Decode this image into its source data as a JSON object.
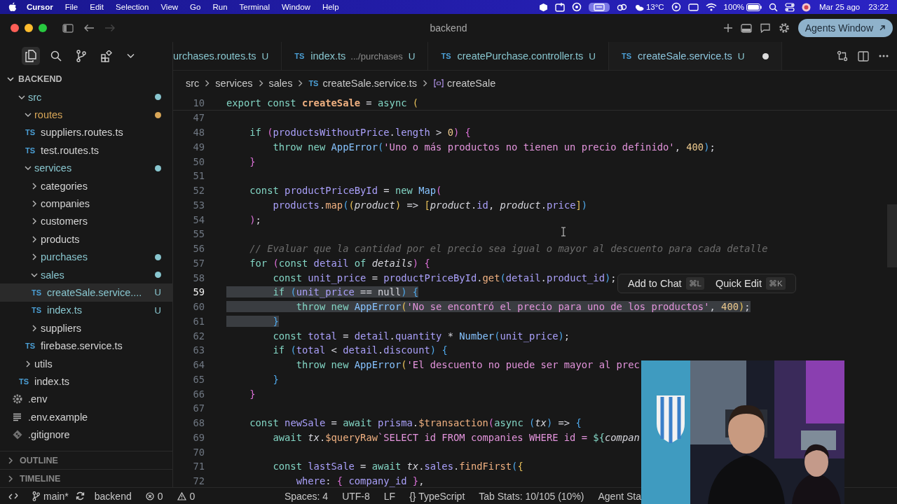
{
  "menubar": {
    "app": "Cursor",
    "items": [
      "File",
      "Edit",
      "Selection",
      "View",
      "Go",
      "Run",
      "Terminal",
      "Window",
      "Help"
    ],
    "weather": "13°C",
    "battery": "100%",
    "date": "Mar 25 ago",
    "time": "23:22"
  },
  "window": {
    "title": "backend",
    "agents_button": "Agents Window"
  },
  "tabs": [
    {
      "label": "urchases.routes.ts",
      "badge": "U",
      "selected": false,
      "dirty": false
    },
    {
      "type_label": "TS",
      "label": "index.ts",
      "description": ".../purchases",
      "badge": "U",
      "selected": false,
      "dirty": false
    },
    {
      "type_label": "TS",
      "label": "createPurchase.controller.ts",
      "badge": "U",
      "selected": false,
      "dirty": false
    },
    {
      "type_label": "TS",
      "label": "createSale.service.ts",
      "badge": "U",
      "selected": true,
      "dirty": true
    }
  ],
  "breadcrumb": [
    {
      "kind": "folder",
      "text": "src"
    },
    {
      "kind": "folder",
      "text": "services"
    },
    {
      "kind": "folder",
      "text": "sales"
    },
    {
      "kind": "file",
      "type_label": "TS",
      "text": "createSale.service.ts"
    },
    {
      "kind": "symbol",
      "text": "createSale"
    }
  ],
  "explorer": {
    "title": "BACKEND",
    "expanded": true,
    "tree": [
      {
        "label": "src",
        "kind": "folder",
        "expanded": true,
        "color": "#88c6cf",
        "selected": false,
        "children": [
          {
            "label": "routes",
            "kind": "folder",
            "expanded": true,
            "color": "#d8a657",
            "selected": false,
            "children": [
              {
                "label": "suppliers.routes.ts",
                "kind": "file",
                "type_label": "TS",
                "selected": false
              },
              {
                "label": "test.routes.ts",
                "kind": "file",
                "type_label": "TS",
                "selected": false
              }
            ]
          },
          {
            "label": "services",
            "kind": "folder",
            "expanded": true,
            "color": "#88c6cf",
            "selected": false,
            "children": [
              {
                "label": "categories",
                "kind": "folder",
                "expanded": false,
                "selected": false
              },
              {
                "label": "companies",
                "kind": "folder",
                "expanded": false,
                "selected": false
              },
              {
                "label": "customers",
                "kind": "folder",
                "expanded": false,
                "selected": false
              },
              {
                "label": "products",
                "kind": "folder",
                "expanded": false,
                "selected": false
              },
              {
                "label": "purchases",
                "kind": "folder",
                "expanded": false,
                "color": "#88c6cf",
                "selected": false
              },
              {
                "label": "sales",
                "kind": "folder",
                "expanded": true,
                "color": "#88c6cf",
                "selected": false,
                "children": [
                  {
                    "label": "createSale.service....",
                    "kind": "file",
                    "type_label": "TS",
                    "color": "#88c6cf",
                    "badge": "U",
                    "selected": true
                  },
                  {
                    "label": "index.ts",
                    "kind": "file",
                    "type_label": "TS",
                    "color": "#88c6cf",
                    "badge": "U",
                    "selected": false
                  }
                ]
              },
              {
                "label": "suppliers",
                "kind": "folder",
                "expanded": false,
                "selected": false
              },
              {
                "label": "firebase.service.ts",
                "kind": "file",
                "type_label": "TS",
                "selected": false
              }
            ]
          },
          {
            "label": "utils",
            "kind": "folder",
            "expanded": false,
            "selected": false
          },
          {
            "label": "index.ts",
            "kind": "file",
            "type_label": "TS",
            "selected": false
          }
        ]
      },
      {
        "label": ".env",
        "kind": "settings",
        "selected": false
      },
      {
        "label": ".env.example",
        "kind": "text",
        "selected": false
      },
      {
        "label": ".gitignore",
        "kind": "git",
        "selected": false
      }
    ]
  },
  "panels": [
    {
      "title": "OUTLINE",
      "expanded": false
    },
    {
      "title": "TIMELINE",
      "expanded": false
    }
  ],
  "sticky_line": {
    "number": "10",
    "tokens": [
      {
        "kind": "keyword",
        "text": "export const "
      },
      {
        "kind": "declaration",
        "text": "createSale"
      },
      {
        "kind": "punctuation",
        "text": " = "
      },
      {
        "kind": "keyword",
        "text": "async "
      },
      {
        "kind": "bracket1",
        "text": "("
      }
    ]
  },
  "code_lines": [
    {
      "number": "47"
    },
    {
      "number": "48",
      "selected": false,
      "current": false,
      "tokens": [
        {
          "kind": "keyword",
          "text": "    if "
        },
        {
          "kind": "bracket2",
          "text": "("
        },
        {
          "kind": "variable",
          "text": "productsWithoutPrice"
        },
        {
          "kind": "punctuation",
          "text": "."
        },
        {
          "kind": "property",
          "text": "length"
        },
        {
          "kind": "punctuation",
          "text": " > "
        },
        {
          "kind": "number",
          "text": "0"
        },
        {
          "kind": "bracket2",
          "text": ")"
        },
        {
          "kind": "bracket2",
          "text": " {"
        }
      ]
    },
    {
      "number": "49",
      "selected": false,
      "current": false,
      "tokens": [
        {
          "kind": "keyword",
          "text": "        throw new "
        },
        {
          "kind": "class",
          "text": "AppError"
        },
        {
          "kind": "bracket3",
          "text": "("
        },
        {
          "kind": "string",
          "text": "'Uno o más productos no tienen un precio definido'"
        },
        {
          "kind": "punctuation",
          "text": ", "
        },
        {
          "kind": "number",
          "text": "400"
        },
        {
          "kind": "bracket3",
          "text": ")"
        },
        {
          "kind": "punctuation",
          "text": ";"
        }
      ]
    },
    {
      "number": "50",
      "selected": false,
      "current": false,
      "tokens": [
        {
          "kind": "bracket2",
          "text": "    }"
        }
      ]
    },
    {
      "number": "51"
    },
    {
      "number": "52",
      "selected": false,
      "current": false,
      "tokens": [
        {
          "kind": "keyword",
          "text": "    const "
        },
        {
          "kind": "variable",
          "text": "productPriceById"
        },
        {
          "kind": "punctuation",
          "text": " = "
        },
        {
          "kind": "keyword",
          "text": "new "
        },
        {
          "kind": "class",
          "text": "Map"
        },
        {
          "kind": "bracket2",
          "text": "("
        }
      ]
    },
    {
      "number": "53",
      "selected": false,
      "current": false,
      "tokens": [
        {
          "kind": "variable",
          "text": "        products"
        },
        {
          "kind": "punctuation",
          "text": "."
        },
        {
          "kind": "function",
          "text": "map"
        },
        {
          "kind": "bracket3",
          "text": "("
        },
        {
          "kind": "bracket1",
          "text": "("
        },
        {
          "kind": "parameter",
          "text": "product"
        },
        {
          "kind": "bracket1",
          "text": ")"
        },
        {
          "kind": "punctuation",
          "text": " => "
        },
        {
          "kind": "bracket1",
          "text": "["
        },
        {
          "kind": "parameter",
          "text": "product"
        },
        {
          "kind": "punctuation",
          "text": "."
        },
        {
          "kind": "property",
          "text": "id"
        },
        {
          "kind": "punctuation",
          "text": ", "
        },
        {
          "kind": "parameter",
          "text": "product"
        },
        {
          "kind": "punctuation",
          "text": "."
        },
        {
          "kind": "property",
          "text": "price"
        },
        {
          "kind": "bracket1",
          "text": "]"
        },
        {
          "kind": "bracket3",
          "text": ")"
        }
      ]
    },
    {
      "number": "54",
      "selected": false,
      "current": false,
      "tokens": [
        {
          "kind": "bracket2",
          "text": "    )"
        },
        {
          "kind": "punctuation",
          "text": ";"
        }
      ]
    },
    {
      "number": "55"
    },
    {
      "number": "56",
      "selected": false,
      "current": false,
      "tokens": [
        {
          "kind": "comment",
          "text": "    // Evaluar que la cantidad por el precio sea igual o mayor al descuento para cada detalle"
        }
      ]
    },
    {
      "number": "57",
      "selected": false,
      "current": false,
      "tokens": [
        {
          "kind": "keyword",
          "text": "    for "
        },
        {
          "kind": "bracket2",
          "text": "("
        },
        {
          "kind": "keyword",
          "text": "const "
        },
        {
          "kind": "variable",
          "text": "detail"
        },
        {
          "kind": "keyword",
          "text": " of "
        },
        {
          "kind": "parameter",
          "text": "details"
        },
        {
          "kind": "bracket2",
          "text": ")"
        },
        {
          "kind": "bracket2",
          "text": " {"
        }
      ]
    },
    {
      "number": "58",
      "selected": false,
      "current": false,
      "tokens": [
        {
          "kind": "keyword",
          "text": "        const "
        },
        {
          "kind": "variable",
          "text": "unit_price"
        },
        {
          "kind": "punctuation",
          "text": " = "
        },
        {
          "kind": "variable",
          "text": "productPriceById"
        },
        {
          "kind": "punctuation",
          "text": "."
        },
        {
          "kind": "function",
          "text": "get"
        },
        {
          "kind": "bracket3",
          "text": "("
        },
        {
          "kind": "variable",
          "text": "detail"
        },
        {
          "kind": "punctuation",
          "text": "."
        },
        {
          "kind": "property",
          "text": "product_id"
        },
        {
          "kind": "bracket3",
          "text": ")"
        },
        {
          "kind": "punctuation",
          "text": ";"
        }
      ]
    },
    {
      "number": "59",
      "selected": true,
      "current": true,
      "tokens": [
        {
          "kind": "keyword",
          "text": "        if "
        },
        {
          "kind": "bracket3",
          "text": "("
        },
        {
          "kind": "variable",
          "text": "unit_price"
        },
        {
          "kind": "punctuation",
          "text": " == null"
        },
        {
          "kind": "bracket3",
          "text": ")"
        },
        {
          "kind": "bracket3",
          "text": " {"
        }
      ]
    },
    {
      "number": "60",
      "selected": true,
      "current": false,
      "tokens": [
        {
          "kind": "keyword",
          "text": "            throw new "
        },
        {
          "kind": "class",
          "text": "AppError"
        },
        {
          "kind": "bracket1",
          "text": "("
        },
        {
          "kind": "string",
          "text": "'No se encontró el precio para uno de los productos'"
        },
        {
          "kind": "punctuation",
          "text": ", "
        },
        {
          "kind": "number",
          "text": "400"
        },
        {
          "kind": "bracket1",
          "text": ")"
        },
        {
          "kind": "punctuation",
          "text": ";"
        }
      ]
    },
    {
      "number": "61",
      "selected": true,
      "current": false,
      "tokens": [
        {
          "kind": "bracket3",
          "text": "        }"
        }
      ]
    },
    {
      "number": "62",
      "selected": false,
      "current": false,
      "tokens": [
        {
          "kind": "keyword",
          "text": "        const "
        },
        {
          "kind": "variable",
          "text": "total"
        },
        {
          "kind": "punctuation",
          "text": " = "
        },
        {
          "kind": "variable",
          "text": "detail"
        },
        {
          "kind": "punctuation",
          "text": "."
        },
        {
          "kind": "property",
          "text": "quantity"
        },
        {
          "kind": "punctuation",
          "text": " * "
        },
        {
          "kind": "class",
          "text": "Number"
        },
        {
          "kind": "bracket3",
          "text": "("
        },
        {
          "kind": "variable",
          "text": "unit_price"
        },
        {
          "kind": "bracket3",
          "text": ")"
        },
        {
          "kind": "punctuation",
          "text": ";"
        }
      ]
    },
    {
      "number": "63",
      "selected": false,
      "current": false,
      "tokens": [
        {
          "kind": "keyword",
          "text": "        if "
        },
        {
          "kind": "bracket3",
          "text": "("
        },
        {
          "kind": "variable",
          "text": "total"
        },
        {
          "kind": "punctuation",
          "text": " < "
        },
        {
          "kind": "variable",
          "text": "detail"
        },
        {
          "kind": "punctuation",
          "text": "."
        },
        {
          "kind": "property",
          "text": "discount"
        },
        {
          "kind": "bracket3",
          "text": ")"
        },
        {
          "kind": "bracket3",
          "text": " {"
        }
      ]
    },
    {
      "number": "64",
      "selected": false,
      "current": false,
      "tokens": [
        {
          "kind": "keyword",
          "text": "            throw new "
        },
        {
          "kind": "class",
          "text": "AppError"
        },
        {
          "kind": "bracket1",
          "text": "("
        },
        {
          "kind": "string",
          "text": "'El descuento no puede ser mayor al prec"
        }
      ]
    },
    {
      "number": "65",
      "selected": false,
      "current": false,
      "tokens": [
        {
          "kind": "bracket3",
          "text": "        }"
        }
      ]
    },
    {
      "number": "66",
      "selected": false,
      "current": false,
      "tokens": [
        {
          "kind": "bracket2",
          "text": "    }"
        }
      ]
    },
    {
      "number": "67"
    },
    {
      "number": "68",
      "selected": false,
      "current": false,
      "tokens": [
        {
          "kind": "keyword",
          "text": "    const "
        },
        {
          "kind": "variable",
          "text": "newSale"
        },
        {
          "kind": "punctuation",
          "text": " = "
        },
        {
          "kind": "keyword",
          "text": "await "
        },
        {
          "kind": "variable",
          "text": "prisma"
        },
        {
          "kind": "punctuation",
          "text": "."
        },
        {
          "kind": "function",
          "text": "$transaction"
        },
        {
          "kind": "bracket2",
          "text": "("
        },
        {
          "kind": "keyword",
          "text": "async "
        },
        {
          "kind": "bracket3",
          "text": "("
        },
        {
          "kind": "parameter",
          "text": "tx"
        },
        {
          "kind": "bracket3",
          "text": ")"
        },
        {
          "kind": "punctuation",
          "text": " => "
        },
        {
          "kind": "bracket3",
          "text": "{"
        }
      ]
    },
    {
      "number": "69",
      "selected": false,
      "current": false,
      "tokens": [
        {
          "kind": "keyword",
          "text": "        await "
        },
        {
          "kind": "parameter",
          "text": "tx"
        },
        {
          "kind": "punctuation",
          "text": "."
        },
        {
          "kind": "function",
          "text": "$queryRaw"
        },
        {
          "kind": "string",
          "text": "`SELECT id FROM companies WHERE id = "
        },
        {
          "kind": "keyword",
          "text": "${"
        },
        {
          "kind": "parameter",
          "text": "compan"
        }
      ]
    },
    {
      "number": "70"
    },
    {
      "number": "71",
      "selected": false,
      "current": false,
      "tokens": [
        {
          "kind": "keyword",
          "text": "        const "
        },
        {
          "kind": "variable",
          "text": "lastSale"
        },
        {
          "kind": "punctuation",
          "text": " = "
        },
        {
          "kind": "keyword",
          "text": "await "
        },
        {
          "kind": "parameter",
          "text": "tx"
        },
        {
          "kind": "punctuation",
          "text": "."
        },
        {
          "kind": "variable",
          "text": "sales"
        },
        {
          "kind": "punctuation",
          "text": "."
        },
        {
          "kind": "function",
          "text": "findFirst"
        },
        {
          "kind": "bracket3",
          "text": "("
        },
        {
          "kind": "bracket1",
          "text": "{"
        }
      ]
    },
    {
      "number": "72",
      "selected": false,
      "current": false,
      "tokens": [
        {
          "kind": "property",
          "text": "            where"
        },
        {
          "kind": "punctuation",
          "text": ": "
        },
        {
          "kind": "bracket2",
          "text": "{"
        },
        {
          "kind": "variable",
          "text": " company_id "
        },
        {
          "kind": "bracket2",
          "text": "}"
        },
        {
          "kind": "punctuation",
          "text": ","
        }
      ]
    }
  ],
  "selection_popup": [
    {
      "label": "Add to Chat",
      "shortcut": "⌘L"
    },
    {
      "label": "Quick Edit",
      "shortcut": "⌘K"
    }
  ],
  "status_bar": {
    "left": [
      {
        "kind": "remote"
      },
      {
        "kind": "branch",
        "text": "main*"
      },
      {
        "kind": "sync"
      },
      {
        "kind": "text",
        "text": "backend"
      },
      {
        "kind": "errors",
        "text": "0"
      },
      {
        "kind": "warnings",
        "text": "0"
      }
    ],
    "right": [
      "Spaces: 4",
      "UTF-8",
      "LF",
      "{} TypeScript",
      "Tab Stats: 10/105 (10%)",
      "Agent Sta"
    ]
  }
}
